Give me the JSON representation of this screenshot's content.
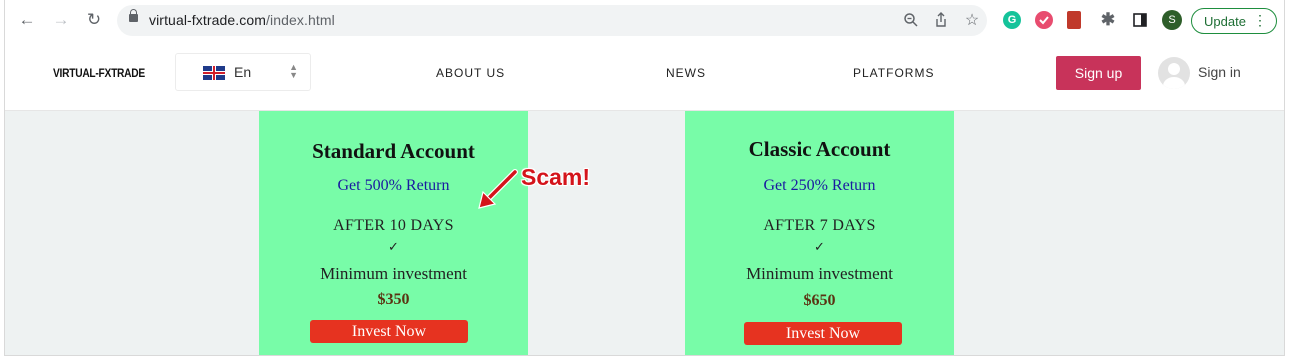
{
  "browser": {
    "url_domain": "virtual-fxtrade.com",
    "url_path": "/index.html",
    "profile_initial": "S",
    "update_label": "Update"
  },
  "site": {
    "logo": "VIRTUAL-FXTRADE",
    "language": "En",
    "menu": [
      "ABOUT US",
      "NEWS",
      "PLATFORMS"
    ],
    "signup_label": "Sign up",
    "signin_label": "Sign in"
  },
  "cards": [
    {
      "title": "Standard Account",
      "return_text": "Get 500% Return",
      "after_text": "AFTER 10 DAYS",
      "check": "✓",
      "min_label": "Minimum investment",
      "amount": "$350",
      "button_label": "Invest Now"
    },
    {
      "title": "Classic Account",
      "return_text": "Get 250% Return",
      "after_text": "AFTER 7 DAYS",
      "check": "✓",
      "min_label": "Minimum investment",
      "amount": "$650",
      "button_label": "Invest Now"
    }
  ],
  "annotation": {
    "label": "Scam!",
    "color": "#d4141b"
  },
  "colors": {
    "card_bg": "#78fca8",
    "invest_button": "#e63320",
    "signup_button": "#c8335a",
    "return_text": "#1a1aa0"
  }
}
